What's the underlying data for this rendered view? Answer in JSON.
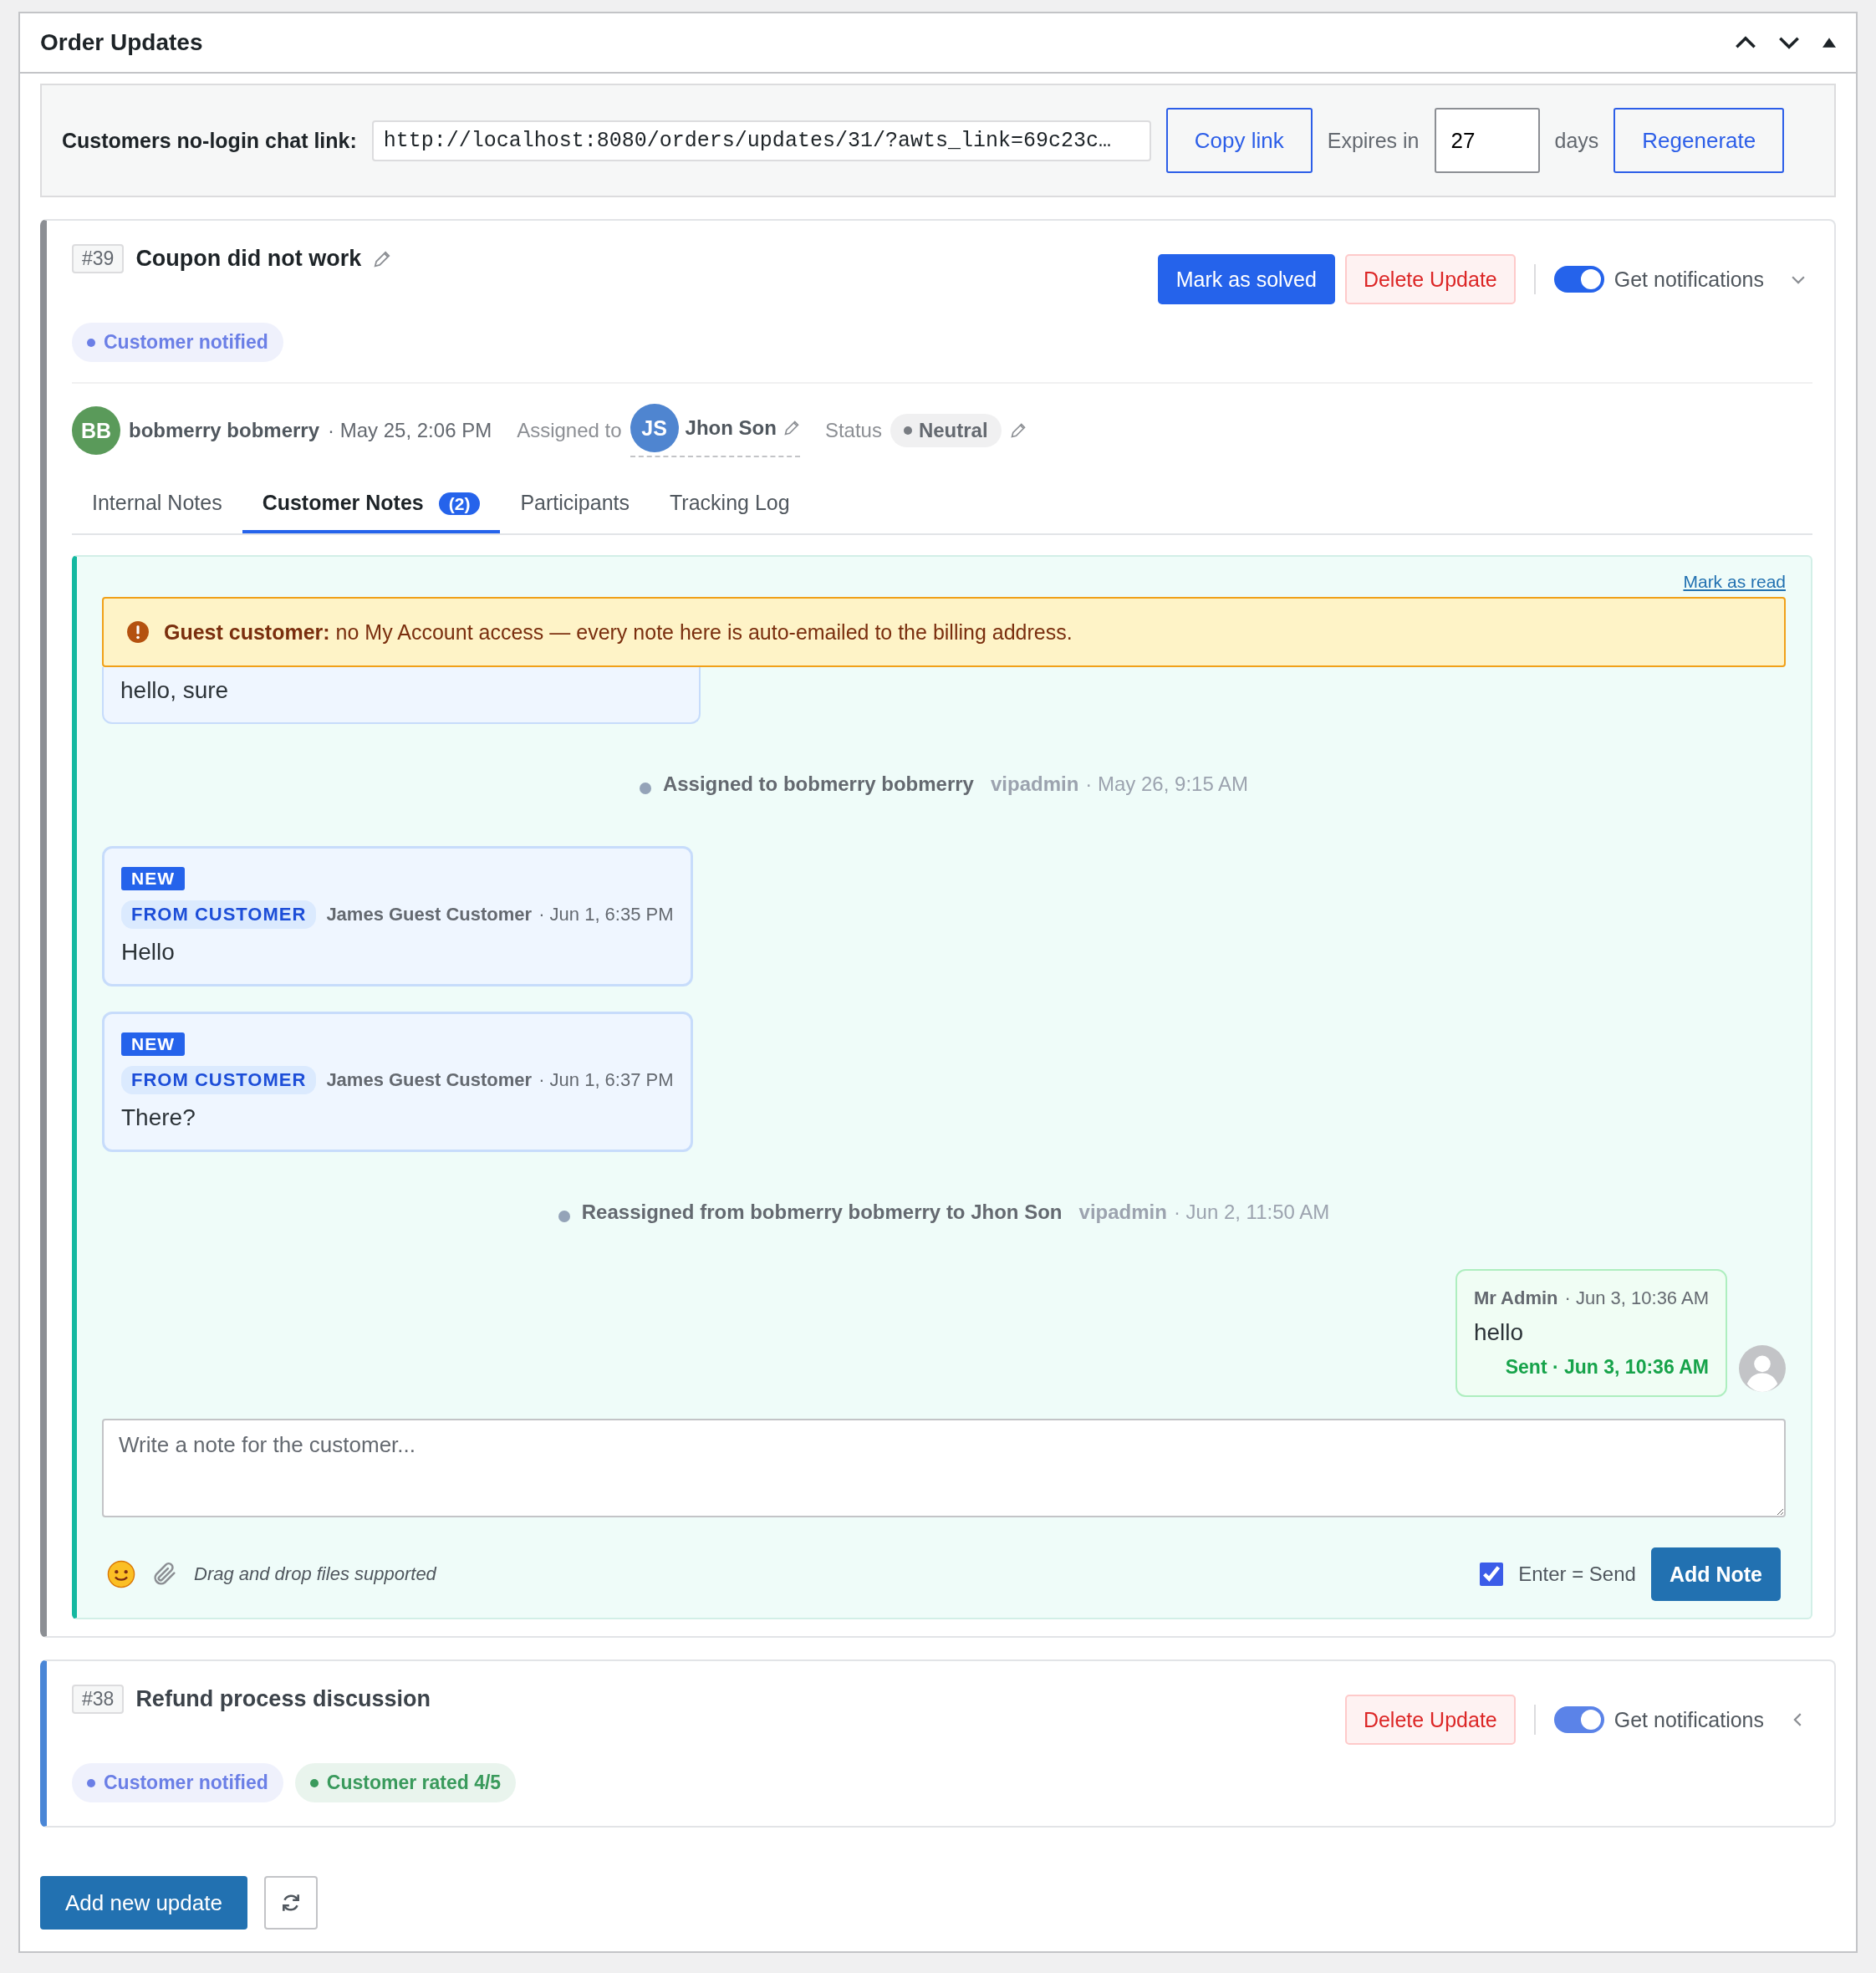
{
  "panel": {
    "title": "Order Updates"
  },
  "link_bar": {
    "label": "Customers no-login chat link:",
    "url": "http://localhost:8080/orders/updates/31/?awts_link=69c23c…",
    "copy_button": "Copy link",
    "expires_label": "Expires in",
    "expires_value": "27",
    "days_label": "days",
    "regenerate_button": "Regenerate"
  },
  "updates": [
    {
      "number": "#39",
      "title": "Coupon did not work",
      "expanded": true,
      "buttons": [
        {
          "label": "Mark as solved",
          "kind": "primary"
        },
        {
          "label": "Delete Update",
          "kind": "danger"
        }
      ],
      "notifications": {
        "label": "Get notifications",
        "on": true
      },
      "tags": [
        {
          "label": "Customer notified",
          "color": "#6b7fe6"
        }
      ],
      "meta": {
        "author_initials": "BB",
        "author": "bobmerry bobmerry",
        "created": "· May 25, 2:06 PM",
        "assigned_label": "Assigned to",
        "assignee_initials": "JS",
        "assignee": "Jhon Son",
        "status_label": "Status",
        "status": "Neutral"
      },
      "tabs": [
        {
          "label": "Internal Notes",
          "selected": false
        },
        {
          "label": "Customer Notes",
          "count": "(2)",
          "selected": true
        },
        {
          "label": "Participants",
          "selected": false
        },
        {
          "label": "Tracking Log",
          "selected": false
        }
      ],
      "chat": {
        "mark_read": "Mark as read",
        "banner": "**Guest customer:** no My Account access — every note here is auto-emailed to the billing address.",
        "items": [
          {
            "kind": "incoming",
            "partial": true,
            "text": "hello, sure"
          },
          {
            "kind": "event",
            "text": "Assigned to bobmerry bobmerry",
            "actor": "vipadmin",
            "time": "· May 26, 9:15 AM"
          },
          {
            "kind": "incoming",
            "partial": false,
            "badge": "NEW",
            "source": "FROM CUSTOMER",
            "author": "James Guest Customer",
            "time": "· Jun 1, 6:35 PM",
            "text": "Hello"
          },
          {
            "kind": "incoming",
            "partial": false,
            "badge": "NEW",
            "source": "FROM CUSTOMER",
            "author": "James Guest Customer",
            "time": "· Jun 1, 6:37 PM",
            "text": "There?"
          },
          {
            "kind": "event",
            "text": "Reassigned from bobmerry bobmerry to Jhon Son",
            "actor": "vipadmin",
            "time": "· Jun 2, 11:50 AM"
          },
          {
            "kind": "outgoing",
            "author": "Mr Admin",
            "time": "· Jun 3, 10:36 AM",
            "text": "hello",
            "delivery": "Sent · Jun 3, 10:36 AM"
          }
        ],
        "composer": {
          "placeholder": "Write a note for the customer...",
          "hint": "Drag and drop files supported",
          "enter_send": {
            "label": "Enter = Send",
            "checked": true
          },
          "button": "Add Note"
        }
      }
    },
    {
      "number": "#38",
      "title": "Refund process discussion",
      "expanded": false,
      "buttons": [
        {
          "label": "Delete Update",
          "kind": "danger"
        }
      ],
      "notifications": {
        "label": "Get notifications",
        "on": true
      },
      "tags": [
        {
          "label": "Customer notified",
          "color": "#6b7fe6"
        },
        {
          "label": "Customer rated 4/5",
          "color": "#3a9a5c"
        }
      ]
    }
  ],
  "footer": {
    "add_button": "Add new update"
  }
}
